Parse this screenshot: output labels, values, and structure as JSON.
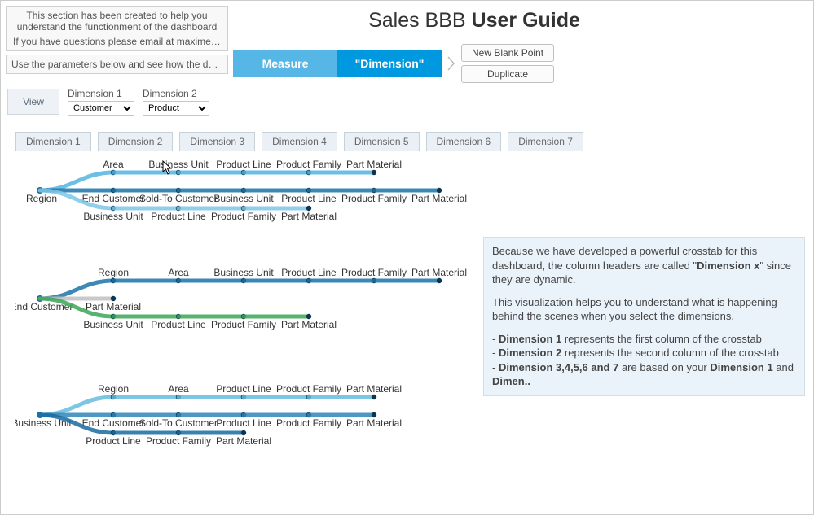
{
  "help": {
    "line1": "This section has been created to help you understand the functionment of the dashboard",
    "line2": "If you have questions please email at maxime.kehon@atm..",
    "params_hint": "Use the parameters below and see how the dashboard will .."
  },
  "title": {
    "prefix": "Sales BBB ",
    "bold": "User Guide"
  },
  "segmented": {
    "measure": "Measure",
    "dimension": "\"Dimension\""
  },
  "buttons": {
    "new_blank": "New Blank Point",
    "duplicate": "Duplicate"
  },
  "controls": {
    "view": "View",
    "dim1_label": "Dimension 1",
    "dim2_label": "Dimension 2",
    "dim1_value": "Customer",
    "dim2_value": "Product"
  },
  "tabs": [
    "Dimension 1",
    "Dimension 2",
    "Dimension 3",
    "Dimension 4",
    "Dimension 5",
    "Dimension 6",
    "Dimension 7"
  ],
  "tree1": {
    "root": "Region",
    "branches": [
      [
        "Area",
        "Business Unit",
        "Product Line",
        "Product Family",
        "Part Material"
      ],
      [
        "End Customer",
        "Sold-To Customer",
        "Business Unit",
        "Product Line",
        "Product Family",
        "Part Material"
      ],
      [
        "Business Unit",
        "Product Line",
        "Product Family",
        "Part Material"
      ]
    ]
  },
  "tree2": {
    "root": "End Customer",
    "branches": [
      [
        "Region",
        "Area",
        "Business Unit",
        "Product Line",
        "Product Family",
        "Part Material"
      ],
      [
        "Part Material"
      ],
      [
        "Business Unit",
        "Product Line",
        "Product Family",
        "Part Material"
      ]
    ]
  },
  "tree3": {
    "root": "Business Unit",
    "branches": [
      [
        "Region",
        "Area",
        "Product Line",
        "Product Family",
        "Part Material"
      ],
      [
        "End Customer",
        "Sold-To Customer",
        "Product Line",
        "Product Family",
        "Part Material"
      ],
      [
        "Product Line",
        "Product Family",
        "Part Material"
      ]
    ]
  },
  "panel": {
    "p1a": "Because we have developed a powerful crosstab for this dashboard, the column headers are called \"",
    "p1b": "Dimension x",
    "p1c": "\" since they are dynamic.",
    "p2": "This visualization helps you to understand what is happening behind the scenes when you select the dimensions.",
    "d1a": "Dimension 1",
    "d1b": " represents the first column of the crosstab",
    "d2a": "Dimension 2",
    "d2b": " represents the second column of the crosstab",
    "d3a": "Dimension 3,4,5,6 and 7",
    "d3b": " are based on your ",
    "d3c": "Dimension 1",
    "d3d": " and ",
    "d3e": "Dimen.."
  },
  "chart_data": {
    "type": "sankey-tree",
    "description": "Hierarchy paths the crosstab will follow given Dimension 1 selection",
    "trees": [
      {
        "root": "Region",
        "paths": [
          [
            "Area",
            "Business Unit",
            "Product Line",
            "Product Family",
            "Part Material"
          ],
          [
            "End Customer",
            "Sold-To Customer",
            "Business Unit",
            "Product Line",
            "Product Family",
            "Part Material"
          ],
          [
            "Business Unit",
            "Product Line",
            "Product Family",
            "Part Material"
          ]
        ]
      },
      {
        "root": "End Customer",
        "paths": [
          [
            "Region",
            "Area",
            "Business Unit",
            "Product Line",
            "Product Family",
            "Part Material"
          ],
          [
            "Part Material"
          ],
          [
            "Business Unit",
            "Product Line",
            "Product Family",
            "Part Material"
          ]
        ]
      },
      {
        "root": "Business Unit",
        "paths": [
          [
            "Region",
            "Area",
            "Product Line",
            "Product Family",
            "Part Material"
          ],
          [
            "End Customer",
            "Sold-To Customer",
            "Product Line",
            "Product Family",
            "Part Material"
          ],
          [
            "Product Line",
            "Product Family",
            "Part Material"
          ]
        ]
      }
    ]
  }
}
